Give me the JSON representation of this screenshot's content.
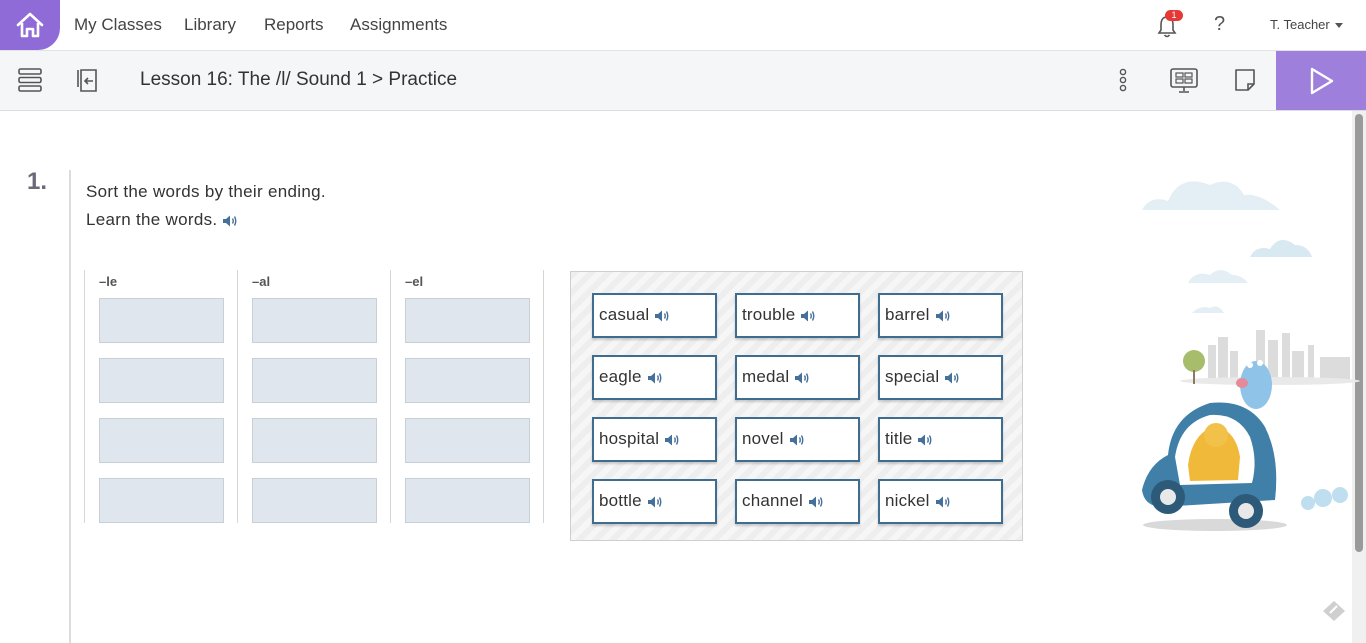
{
  "nav": {
    "links": [
      "My Classes",
      "Library",
      "Reports",
      "Assignments"
    ],
    "notification_count": "1",
    "help": "?",
    "user": "T. Teacher"
  },
  "lesson": {
    "title": "Lesson 16: The /l/ Sound 1 > Practice"
  },
  "question": {
    "number": "1.",
    "instruction_1": "Sort the words by their ending.",
    "instruction_2": "Learn the words.",
    "columns": [
      "–le",
      "–al",
      "–el"
    ],
    "words": [
      "casual",
      "trouble",
      "barrel",
      "eagle",
      "medal",
      "special",
      "hospital",
      "novel",
      "title",
      "bottle",
      "channel",
      "nickel"
    ]
  },
  "colors": {
    "accent": "#8e6bd6",
    "play": "#9e7fdc",
    "card_border": "#3e6d8f",
    "slot": "#dfe6ee"
  },
  "icons": [
    "home-icon",
    "notification-bell-icon",
    "help-icon",
    "chevron-down-icon",
    "list-view-icon",
    "assign-icon",
    "more-vertical-icon",
    "present-icon",
    "notes-icon",
    "play-icon",
    "speaker-icon"
  ]
}
